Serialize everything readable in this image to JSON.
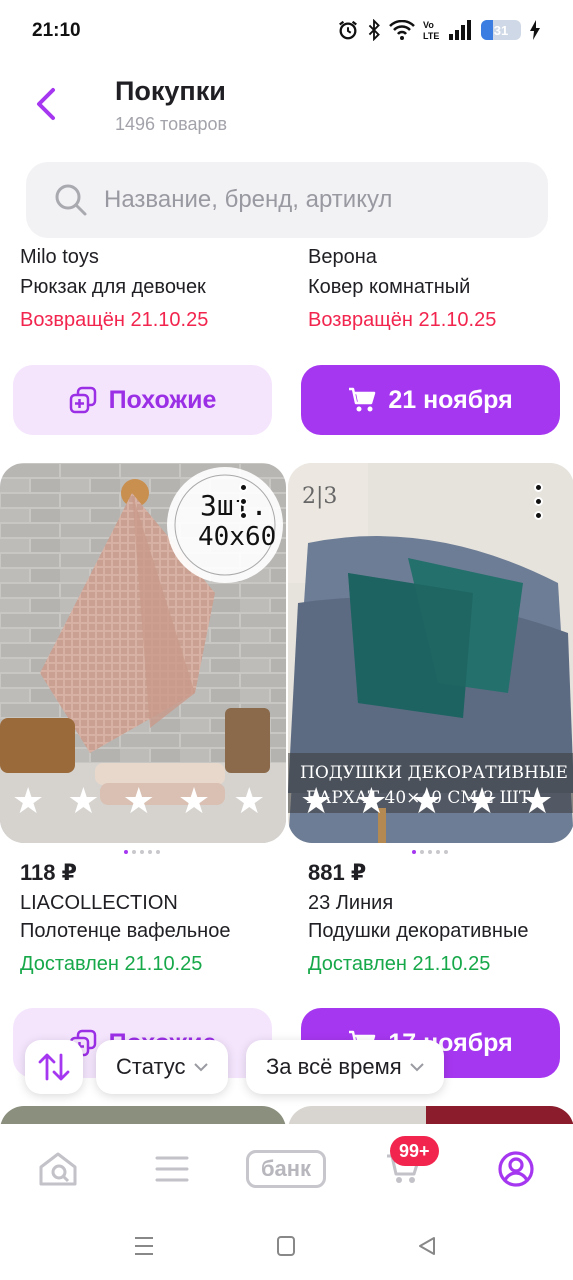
{
  "status_bar": {
    "time": "21:10",
    "battery": "31",
    "battery_level": 0.31
  },
  "header": {
    "title": "Покупки",
    "subtitle": "1496 товаров"
  },
  "search": {
    "placeholder": "Название, бренд, артикул"
  },
  "products_top": [
    {
      "brand": "Milo toys",
      "name": "Рюкзак для девочек",
      "status": "Возвращён 21.10.25"
    },
    {
      "brand": "Верона",
      "name": "Ковер комнатный",
      "status": "Возвращён 21.10.25"
    }
  ],
  "buttons_row1": {
    "similar": "Похожие",
    "cart": "21 ноября"
  },
  "products": [
    {
      "price": "118 ₽",
      "brand": "LIACOLLECTION",
      "name": "Полотенце вафельное",
      "status": "Доставлен 21.10.25",
      "rating": 5,
      "photo_text": "3шт. 40х60"
    },
    {
      "price": "881 ₽",
      "brand": "23 Линия",
      "name": "Подушки декоративные",
      "status": "Доставлен 21.10.25",
      "rating": 5,
      "photo_text": "ПОДУШКИ ДЕКОРАТИВНЫЕ БАРХАТ 40×40 СМ 2 ШТ",
      "photo_logo": "2|3"
    }
  ],
  "buttons_row2": {
    "similar": "Похожие",
    "cart": "17 ноября"
  },
  "filters": {
    "status": "Статус",
    "period": "За всё время"
  },
  "bottom_nav": {
    "bank": "банк",
    "cart_badge": "99+"
  },
  "colors": {
    "accent": "#a637f0",
    "accent_light": "#f4e5fd",
    "returned": "#f2254e",
    "delivered": "#17a84a"
  }
}
